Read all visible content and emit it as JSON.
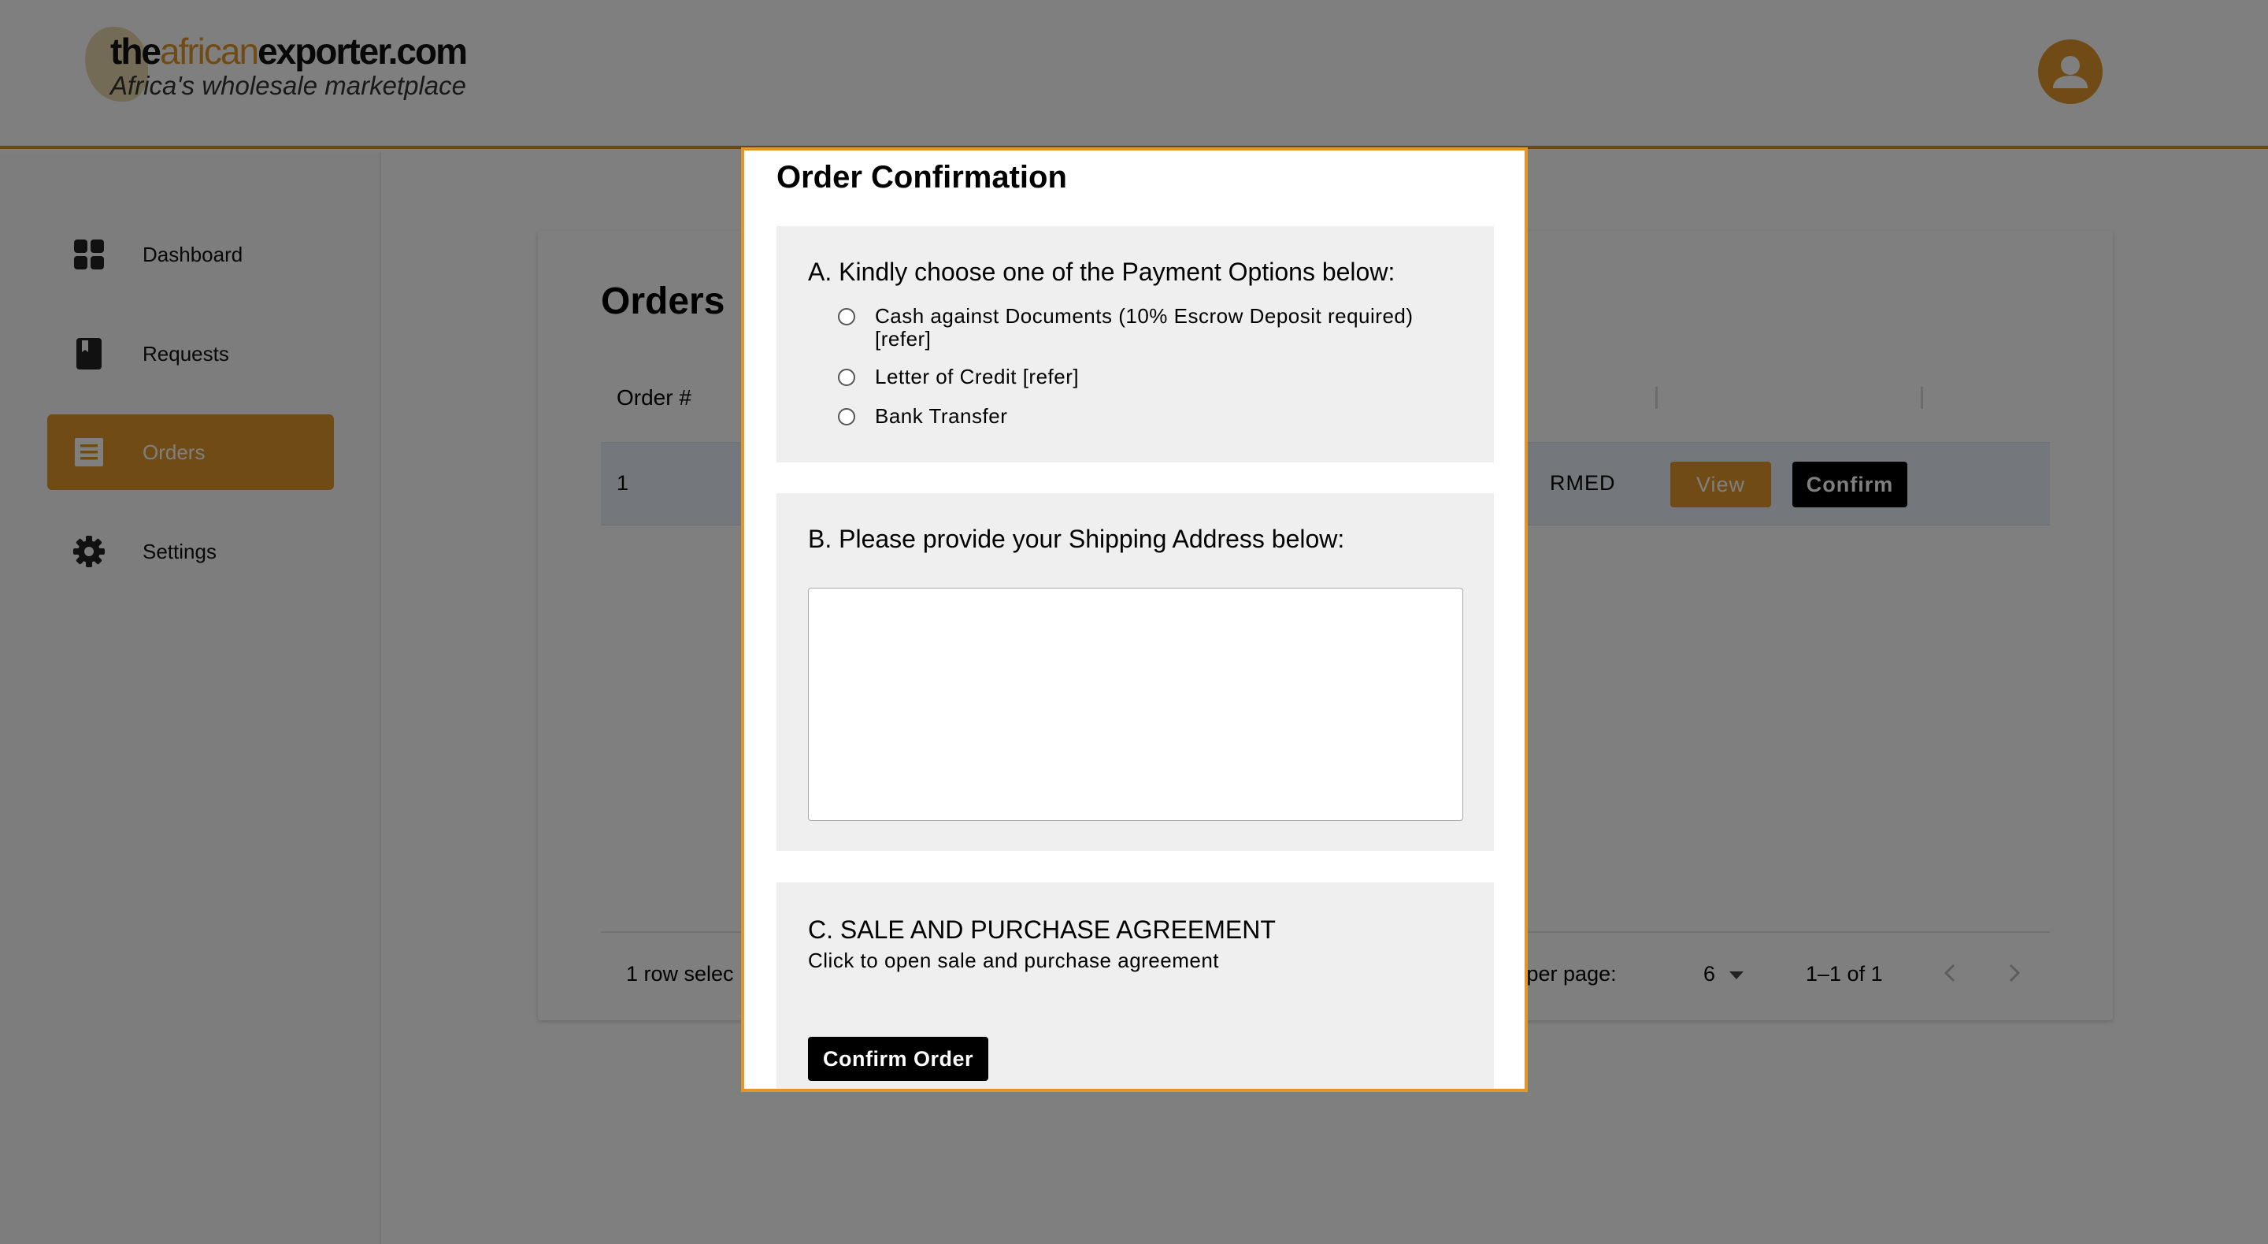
{
  "header": {
    "logo_text_the": "the",
    "logo_text_african": "african",
    "logo_text_exporter": "exporter.com",
    "logo_tagline": "Africa's wholesale marketplace",
    "avatar_icon": "account-circle-icon"
  },
  "sidebar": {
    "items": [
      {
        "label": "Dashboard",
        "icon": "dashboard-grid-icon",
        "active": false
      },
      {
        "label": "Requests",
        "icon": "book-icon",
        "active": false
      },
      {
        "label": "Orders",
        "icon": "receipt-list-icon",
        "active": true
      },
      {
        "label": "Settings",
        "icon": "gear-icon",
        "active": false
      }
    ]
  },
  "orders": {
    "title": "Orders",
    "column_order": "Order #",
    "rows": [
      {
        "order_no": "1",
        "status_visible": "RMED",
        "view_label": "View",
        "confirm_label": "Confirm"
      }
    ],
    "footer": {
      "selected_text": "1 row selec",
      "rows_per_page_label": "ows per page:",
      "rows_per_page_value": "6",
      "range": "1–1 of 1"
    }
  },
  "modal": {
    "title": "Order Confirmation",
    "section_a": {
      "heading": "A. Kindly choose one of the Payment Options below:",
      "options": [
        {
          "line1": "Cash against Documents (10% Escrow Deposit required)",
          "line2": "[refer]"
        },
        {
          "line1": "Letter of Credit [refer]",
          "line2": ""
        },
        {
          "line1": "Bank Transfer",
          "line2": ""
        }
      ]
    },
    "section_b": {
      "heading": "B. Please provide your Shipping Address below:",
      "address_value": ""
    },
    "section_c": {
      "heading": "C. SALE AND PURCHASE AGREEMENT",
      "link_text": "Click to open sale and purchase agreement",
      "confirm_button": "Confirm Order"
    }
  },
  "colors": {
    "accent": "#e0962a",
    "dark_button": "#000000",
    "overlay": "rgba(0,0,0,0.5)",
    "section_bg": "#efefef"
  }
}
